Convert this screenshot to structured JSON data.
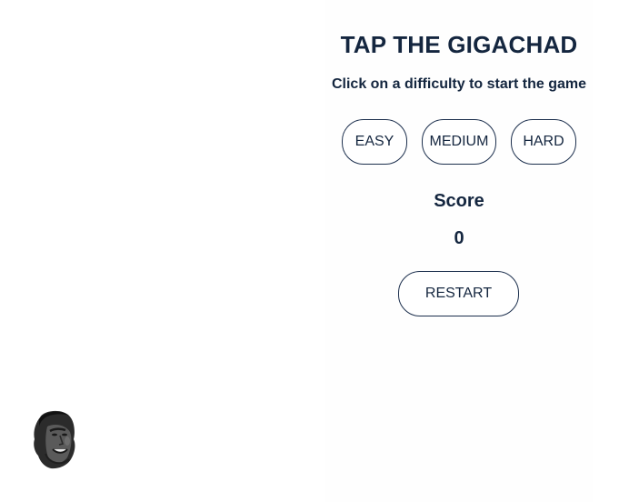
{
  "game": {
    "title": "TAP THE GIGACHAD",
    "instruction": "Click on a difficulty to start the game"
  },
  "difficulty": {
    "easy_label": "EASY",
    "medium_label": "MEDIUM",
    "hard_label": "HARD"
  },
  "score": {
    "label": "Score",
    "value": "0"
  },
  "controls": {
    "restart_label": "RESTART"
  },
  "target": {
    "icon": "gigachad-face-icon"
  },
  "colors": {
    "text": "#14263f",
    "border": "#1c2f4d",
    "background": "#ffffff"
  }
}
